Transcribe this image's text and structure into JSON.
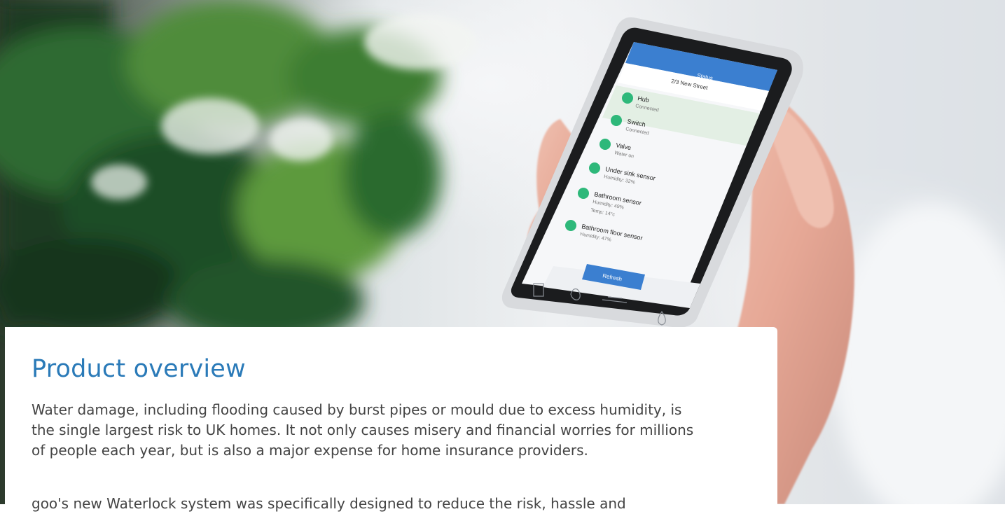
{
  "hero": {
    "phone": {
      "header_title": "Status",
      "address": "2/3 New Street",
      "devices": [
        {
          "name": "Hub",
          "detail": "Connected",
          "detail2": ""
        },
        {
          "name": "Switch",
          "detail": "Connected",
          "detail2": ""
        },
        {
          "name": "Valve",
          "detail": "Water on",
          "detail2": ""
        },
        {
          "name": "Under sink sensor",
          "detail": "Humidity: 32%",
          "detail2": ""
        },
        {
          "name": "Bathroom sensor",
          "detail": "Humidity: 49%",
          "detail2": "Temp: 14°c"
        },
        {
          "name": "Bathroom floor sensor",
          "detail": "Humidity: 47%",
          "detail2": ""
        }
      ],
      "refresh_label": "Refresh",
      "accent": "#3b7fd0",
      "status_green": "#2eb87a",
      "highlight": "#e3efe4"
    }
  },
  "overview": {
    "title": "Product overview",
    "paragraph1": "Water damage, including flooding caused by burst pipes or mould due to excess humidity, is the single largest risk to UK homes. It not only causes misery and financial worries for millions of people each year, but is also a major expense for home insurance providers.",
    "paragraph2": "goo's new Waterlock system was specifically designed to reduce the risk, hassle and"
  }
}
